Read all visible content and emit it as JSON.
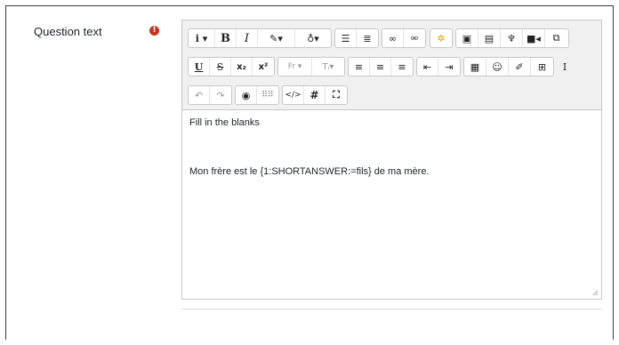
{
  "field": {
    "label": "Question text",
    "required_icon": "exclamation-circle-icon",
    "required_color": "#ca3120"
  },
  "toolbar": {
    "row1": [
      {
        "name": "info-dropdown",
        "icon": "info-icon",
        "glyph": "i ▾"
      },
      {
        "name": "bold",
        "icon": "bold-icon",
        "glyph": "B"
      },
      {
        "name": "italic",
        "icon": "italic-icon",
        "glyph": "I"
      },
      {
        "name": "text-color",
        "icon": "brush-icon",
        "glyph": "✎▾"
      },
      {
        "name": "background-color",
        "icon": "paint-bucket-icon",
        "glyph": "♁▾"
      },
      {
        "name": "unordered-list",
        "icon": "bullet-list-icon",
        "glyph": "☰"
      },
      {
        "name": "ordered-list",
        "icon": "numbered-list-icon",
        "glyph": "≣"
      },
      {
        "name": "link",
        "icon": "link-icon",
        "glyph": "∞"
      },
      {
        "name": "unlink",
        "icon": "unlink-icon",
        "glyph": "⚮"
      },
      {
        "name": "emoji-picker",
        "icon": "sparkle-icon",
        "glyph": "✲"
      },
      {
        "name": "image",
        "icon": "image-icon",
        "glyph": "▣"
      },
      {
        "name": "media",
        "icon": "file-media-icon",
        "glyph": "▤"
      },
      {
        "name": "record-audio",
        "icon": "microphone-icon",
        "glyph": "🎙"
      },
      {
        "name": "record-video",
        "icon": "video-camera-icon",
        "glyph": "■"
      },
      {
        "name": "manage-files",
        "icon": "copy-files-icon",
        "glyph": "⧉"
      }
    ],
    "row2": [
      {
        "name": "underline",
        "icon": "underline-icon",
        "glyph": "U"
      },
      {
        "name": "strikethrough",
        "icon": "strikethrough-icon",
        "glyph": "S"
      },
      {
        "name": "subscript",
        "icon": "subscript-icon",
        "glyph": "x₂"
      },
      {
        "name": "superscript",
        "icon": "superscript-icon",
        "glyph": "x²"
      },
      {
        "name": "font-family",
        "icon": "font-family-icon",
        "glyph": "Fr ▾"
      },
      {
        "name": "font-size",
        "icon": "font-size-icon",
        "glyph": "Tᵢ▾"
      },
      {
        "name": "align-left",
        "icon": "align-left-icon",
        "glyph": "≡"
      },
      {
        "name": "align-center",
        "icon": "align-center-icon",
        "glyph": "≡"
      },
      {
        "name": "align-right",
        "icon": "align-right-icon",
        "glyph": "≡"
      },
      {
        "name": "outdent",
        "icon": "outdent-icon",
        "glyph": "⇤"
      },
      {
        "name": "indent",
        "icon": "indent-icon",
        "glyph": "⇥"
      },
      {
        "name": "equation",
        "icon": "calculator-icon",
        "glyph": "▦"
      },
      {
        "name": "insert-emoticon",
        "icon": "smiley-icon",
        "glyph": "☺"
      },
      {
        "name": "edit-icon",
        "icon": "pencil-square-icon",
        "glyph": "✐"
      },
      {
        "name": "table",
        "icon": "table-icon",
        "glyph": "▦"
      },
      {
        "name": "clear-formatting",
        "icon": "text-cursor-icon",
        "glyph": "I"
      }
    ],
    "row3": [
      {
        "name": "undo",
        "icon": "undo-icon",
        "glyph": "↶"
      },
      {
        "name": "redo",
        "icon": "redo-icon",
        "glyph": "↷"
      },
      {
        "name": "accessibility-checker",
        "icon": "accessibility-icon",
        "glyph": "◉"
      },
      {
        "name": "screen-reader-helper",
        "icon": "braille-icon",
        "glyph": "⠿⠿"
      },
      {
        "name": "html-source",
        "icon": "code-icon",
        "glyph": "</>"
      },
      {
        "name": "hashtag",
        "icon": "hashtag-icon",
        "glyph": "#"
      },
      {
        "name": "fullscreen",
        "icon": "expand-icon",
        "glyph": "⛶"
      }
    ]
  },
  "content": {
    "line1": "Fill in the blanks",
    "line2": "Mon frère est le {1:SHORTANSWER:=fils} de ma mère."
  }
}
